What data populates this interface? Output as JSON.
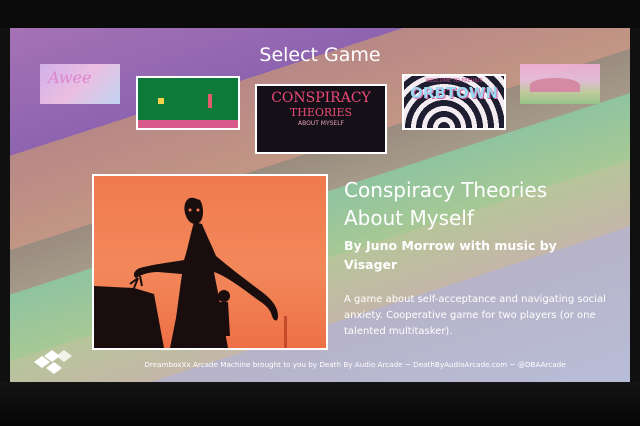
{
  "header": {
    "title": "Select Game"
  },
  "carousel": [
    {
      "id": "awee",
      "label": "Awee"
    },
    {
      "id": "platformer",
      "label": ""
    },
    {
      "id": "conspiracy",
      "line1": "CONSPIRACY",
      "line2": "THEORIES",
      "line3": "ABOUT MYSELF"
    },
    {
      "id": "orbtown",
      "small": "WELCOME TO PREVIUS",
      "big": "ORBTOWN"
    },
    {
      "id": "sunset",
      "label": ""
    }
  ],
  "selected_game": {
    "title_line1": "Conspiracy Theories",
    "title_line2": "About Myself",
    "byline_line1": "By Juno Morrow with music by",
    "byline_line2": "Visager",
    "description": "A game about self-acceptance and navigating social anxiety. Cooperative game for two players (or one talented multitasker)."
  },
  "footer": {
    "text": "DreamboxXx Arcade Machine brought to you by Death By Audio Arcade ~ DeathByAudioArcade.com ~ @DBAArcade"
  },
  "colors": {
    "hero_bg": "#f07a4e",
    "silhouette": "#1a0d0d",
    "accent_pink": "#e84a74"
  }
}
